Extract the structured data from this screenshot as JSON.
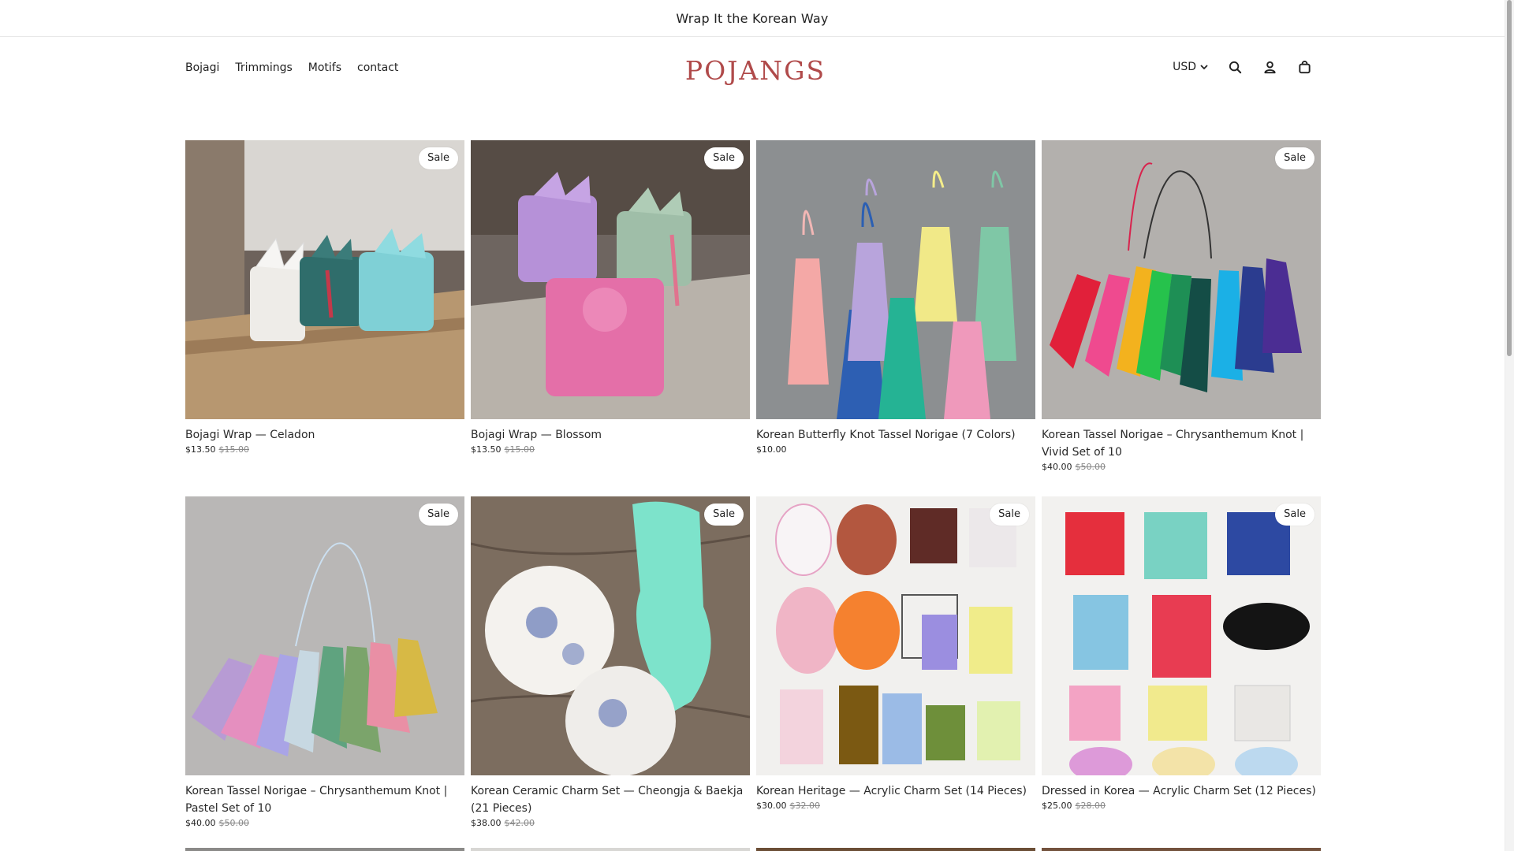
{
  "announcement": {
    "text": "Wrap It the Korean Way"
  },
  "header": {
    "nav": [
      {
        "label": "Bojagi"
      },
      {
        "label": "Trimmings"
      },
      {
        "label": "Motifs"
      },
      {
        "label": "contact"
      }
    ],
    "logo_text": "POJANGS",
    "currency": "USD",
    "icons": [
      "search-icon",
      "account-icon",
      "cart-icon"
    ]
  },
  "badge_label": "Sale",
  "products": [
    {
      "title": "Bojagi Wrap — Celadon",
      "price": "$13.50",
      "compare_price": "$15.00",
      "on_sale": true
    },
    {
      "title": "Bojagi Wrap — Blossom",
      "price": "$13.50",
      "compare_price": "$15.00",
      "on_sale": true
    },
    {
      "title": "Korean Butterfly Knot Tassel Norigae (7 Colors)",
      "price": "$10.00",
      "compare_price": "",
      "on_sale": false
    },
    {
      "title": "Korean Tassel Norigae – Chrysanthemum Knot | Vivid Set of 10",
      "price": "$40.00",
      "compare_price": "$50.00",
      "on_sale": true
    },
    {
      "title": "Korean Tassel Norigae – Chrysanthemum Knot | Pastel Set of 10",
      "price": "$40.00",
      "compare_price": "$50.00",
      "on_sale": true
    },
    {
      "title": "Korean Ceramic Charm Set — Cheongja & Baekja (21 Pieces)",
      "price": "$38.00",
      "compare_price": "$42.00",
      "on_sale": true
    },
    {
      "title": "Korean Heritage — Acrylic Charm Set (14 Pieces)",
      "price": "$30.00",
      "compare_price": "$32.00",
      "on_sale": true
    },
    {
      "title": "Dressed in Korea — Acrylic Charm Set (12 Pieces)",
      "price": "$25.00",
      "compare_price": "$28.00",
      "on_sale": true
    }
  ],
  "colors": {
    "logo": "#b04a4a",
    "text": "#222222",
    "muted": "#888888"
  }
}
